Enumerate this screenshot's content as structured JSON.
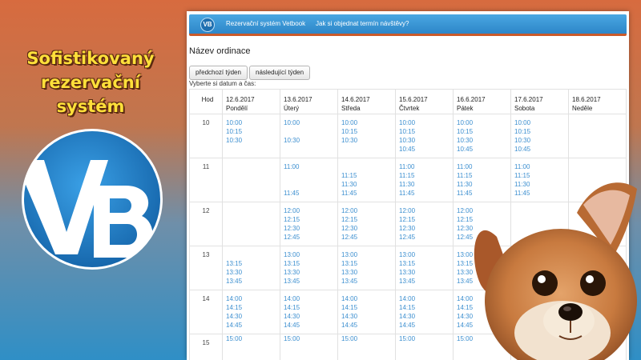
{
  "promo": {
    "line1": "Sofistikovaný",
    "line2": "rezervační systém"
  },
  "logo_letters": "VB",
  "navbar": {
    "logo_text": "VB",
    "brand": "Rezervační systém Vetbook",
    "link": "Jak si objednat termín návštěvy?"
  },
  "page_title": "Název ordinace",
  "buttons": {
    "prev": "předchozí týden",
    "next": "následující týden"
  },
  "hint": "Vyberte si datum a čas:",
  "table": {
    "hour_header": "Hod",
    "days": [
      {
        "date": "12.6.2017",
        "name": "Pondělí"
      },
      {
        "date": "13.6.2017",
        "name": "Úterý"
      },
      {
        "date": "14.6.2017",
        "name": "Středa"
      },
      {
        "date": "15.6.2017",
        "name": "Čtvrtek"
      },
      {
        "date": "16.6.2017",
        "name": "Pátek"
      },
      {
        "date": "17.6.2017",
        "name": "Sobota"
      },
      {
        "date": "18.6.2017",
        "name": "Neděle"
      }
    ],
    "rows": [
      {
        "hour": "10",
        "slots": [
          [
            "10:00",
            "10:15",
            "10:30",
            ""
          ],
          [
            "10:00",
            "",
            "10:30",
            ""
          ],
          [
            "10:00",
            "10:15",
            "10:30",
            ""
          ],
          [
            "10:00",
            "10:15",
            "10:30",
            "10:45"
          ],
          [
            "10:00",
            "10:15",
            "10:30",
            "10:45"
          ],
          [
            "10:00",
            "10:15",
            "10:30",
            "10:45"
          ],
          [
            "",
            "",
            "",
            ""
          ]
        ]
      },
      {
        "hour": "11",
        "slots": [
          [
            "",
            "",
            "",
            ""
          ],
          [
            "11:00",
            "",
            "",
            "11:45"
          ],
          [
            "",
            "11:15",
            "11:30",
            "11:45"
          ],
          [
            "11:00",
            "11:15",
            "11:30",
            "11:45"
          ],
          [
            "11:00",
            "11:15",
            "11:30",
            "11:45"
          ],
          [
            "11:00",
            "11:15",
            "11:30",
            "11:45"
          ],
          [
            "",
            "",
            "",
            ""
          ]
        ]
      },
      {
        "hour": "12",
        "slots": [
          [
            "",
            "",
            "",
            ""
          ],
          [
            "12:00",
            "12:15",
            "12:30",
            "12:45"
          ],
          [
            "12:00",
            "12:15",
            "12:30",
            "12:45"
          ],
          [
            "12:00",
            "12:15",
            "12:30",
            "12:45"
          ],
          [
            "12:00",
            "12:15",
            "12:30",
            "12:45"
          ],
          [
            "",
            "",
            "",
            ""
          ],
          [
            "",
            "",
            "",
            ""
          ]
        ]
      },
      {
        "hour": "13",
        "slots": [
          [
            "",
            "13:15",
            "13:30",
            "13:45"
          ],
          [
            "13:00",
            "13:15",
            "13:30",
            "13:45"
          ],
          [
            "13:00",
            "13:15",
            "13:30",
            "13:45"
          ],
          [
            "13:00",
            "13:15",
            "13:30",
            "13:45"
          ],
          [
            "13:00",
            "13:15",
            "13:30",
            "13:45"
          ],
          [
            "",
            "",
            "",
            ""
          ],
          [
            "",
            "",
            "",
            ""
          ]
        ]
      },
      {
        "hour": "14",
        "slots": [
          [
            "14:00",
            "14:15",
            "14:30",
            "14:45"
          ],
          [
            "14:00",
            "14:15",
            "14:30",
            "14:45"
          ],
          [
            "14:00",
            "14:15",
            "14:30",
            "14:45"
          ],
          [
            "14:00",
            "14:15",
            "14:30",
            "14:45"
          ],
          [
            "14:00",
            "14:15",
            "14:30",
            "14:45"
          ],
          [
            "",
            "",
            "",
            ""
          ],
          [
            "",
            "",
            "",
            ""
          ]
        ]
      },
      {
        "hour": "15",
        "slots": [
          [
            "15:00",
            "",
            "",
            ""
          ],
          [
            "15:00",
            "",
            "",
            ""
          ],
          [
            "15:00",
            "",
            "",
            ""
          ],
          [
            "15:00",
            "",
            "",
            ""
          ],
          [
            "15:00",
            "",
            "",
            ""
          ],
          [
            "",
            "",
            "",
            ""
          ],
          [
            "",
            "",
            "",
            ""
          ]
        ]
      }
    ]
  },
  "colors": {
    "slot_link": "#3c8fd0",
    "promo_text": "#ffe03a",
    "navbar": "#2d86c8",
    "navbar_accent": "#c95a2a",
    "logo_circle": "#1f6fb0"
  },
  "icons": {
    "logo": "vb-logo-icon",
    "dog": "dog-photo"
  }
}
